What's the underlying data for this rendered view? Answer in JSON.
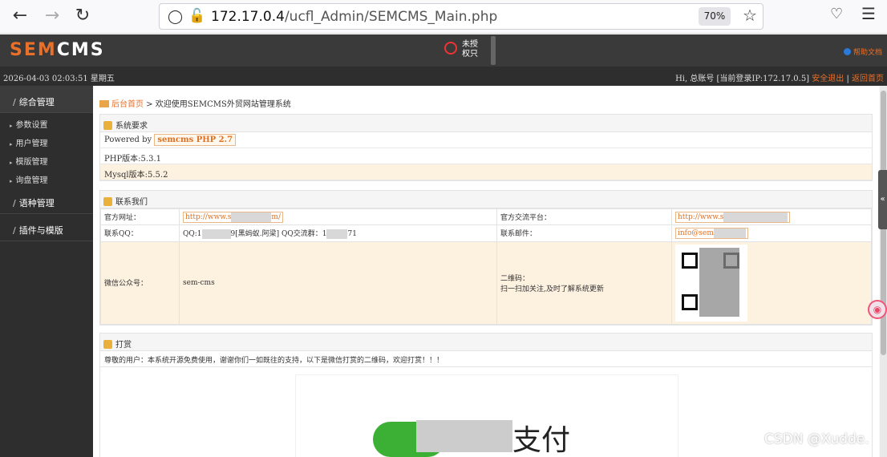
{
  "browser": {
    "url_host": "172.17.0.4",
    "url_path": "/ucfl_Admin/SEMCMS_Main.php",
    "zoom": "70%"
  },
  "header": {
    "logo_a": "SEM",
    "logo_b": "CMS",
    "unauth_line1": "未授",
    "unauth_line2": "权只",
    "help": "帮助文档"
  },
  "subheader": {
    "datetime": "2026-04-03 02:03:51 星期五",
    "greeting": "Hi, 总账号 [当前登录IP:172.17.0.5] ",
    "logout": "安全退出",
    "back": "返回首页"
  },
  "sidebar": {
    "sections": [
      {
        "label": "综合管理",
        "items": [
          "参数设置",
          "用户管理",
          "模版管理",
          "询盘管理"
        ]
      },
      {
        "label": "语种管理",
        "items": []
      },
      {
        "label": "插件与模版",
        "items": []
      }
    ]
  },
  "breadcrumb": {
    "home": "后台首页",
    "rest": " > 欢迎使用SEMCMS外贸网站管理系统"
  },
  "sysreq": {
    "title": "系统要求",
    "powered_label": "Powered by ",
    "powered_value": "semcms PHP 2.7",
    "php": "PHP版本:5.3.1",
    "mysql": "Mysql版本:5.5.2"
  },
  "contact": {
    "title": "联系我们",
    "site_label": "官方网址：",
    "site_value": "http://www.s",
    "site_value_tail": "m/",
    "platform_label": "官方交流平台：",
    "platform_value": "http://www.s",
    "qq_label": "联系QQ：",
    "qq_value_a": "QQ:1",
    "qq_value_b": "9[黑蚂蚁.阿梁] QQ交流群：1",
    "qq_value_c": "71",
    "email_label": "联系邮件：",
    "email_value": "info@sem",
    "wechat_label": "微信公众号：",
    "wechat_value": "sem-cms",
    "qr_label": "二维码：",
    "qr_desc": "扫一扫加关注,及时了解系统更新"
  },
  "donate": {
    "title": "打赏",
    "note": "尊敬的用户：本系统开源免费使用，谢谢你们一如既往的支持，以下是微信打赏的二维码，欢迎打赏！！！",
    "pay_text": "支付"
  },
  "watermark": "CSDN @Xudde."
}
